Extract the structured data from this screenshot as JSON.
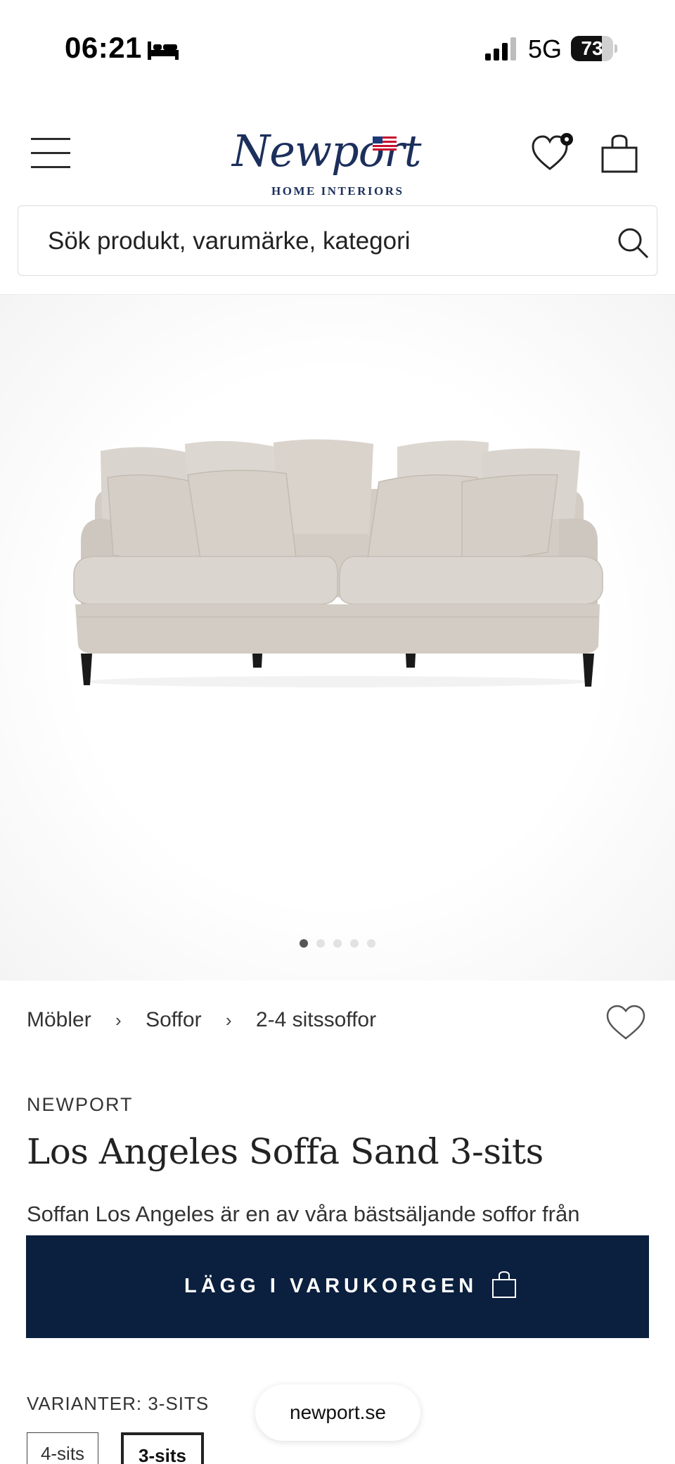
{
  "status_bar": {
    "time": "06:21",
    "network": "5G",
    "battery_percent": "73",
    "battery_level": 0.73
  },
  "header": {
    "logo_script": "Newport",
    "logo_subtitle": "HOME INTERIORS"
  },
  "search": {
    "placeholder": "Sök produkt, varumärke, kategori"
  },
  "gallery": {
    "image_count": 5,
    "active_index": 0
  },
  "breadcrumb": [
    "Möbler",
    "Soffor",
    "2-4 sitssoffor"
  ],
  "product": {
    "brand": "NEWPORT",
    "title": "Los Angeles Soffa Sand 3-sits",
    "description": "Soffan Los Angeles är en av våra bästsäljande soffor från"
  },
  "add_to_cart": {
    "label": "LÄGG I VARUKORGEN"
  },
  "variants": {
    "label": "VARIANTER: 3-SITS",
    "options": [
      "4-sits",
      "3-sits"
    ],
    "selected": "3-sits"
  },
  "url_pill": "newport.se",
  "colors": {
    "primary_navy": "#0b1f3e",
    "logo_blue": "#1c2f5c",
    "sofa_fabric": "#d8d3cc"
  }
}
